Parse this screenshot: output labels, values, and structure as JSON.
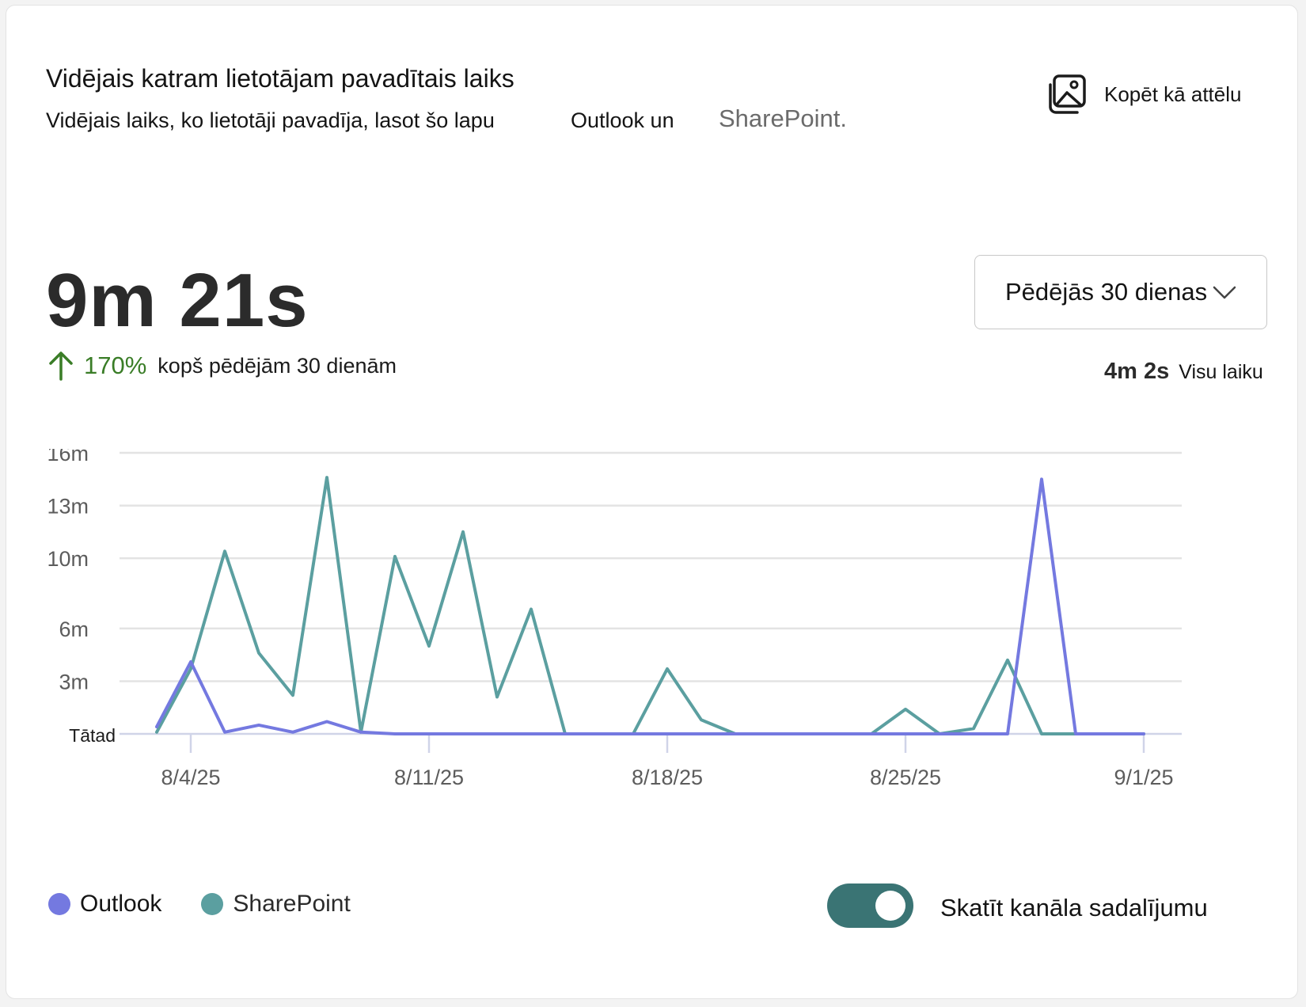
{
  "header": {
    "title": "Vidējais katram lietotājam pavadītais laiks",
    "subtitle": "Vidējais laiks, ko lietotāji pavadīja, lasot šo lapu",
    "subtitle_outlook": "Outlook un",
    "subtitle_sharepoint": "SharePoint.",
    "copy_label": "Kopēt kā attēlu",
    "copy_icon": "image-icon"
  },
  "summary": {
    "value": "9m 21s",
    "change_percent": "170%",
    "change_text": "kopš pēdējām 30 dienām",
    "change_icon": "arrow-up-icon",
    "all_time_value": "4m 2s",
    "all_time_label": "Visu laiku"
  },
  "period_select": {
    "selected": "Pēdējās 30 dienas",
    "icon": "chevron-down-icon"
  },
  "colors": {
    "outlook": "#7479e0",
    "sharepoint": "#5b9fa0",
    "positive": "#3a7d27",
    "toggle": "#3a7474",
    "grid": "#e3e3e3"
  },
  "chart_data": {
    "type": "line",
    "x": [
      "8/3/25",
      "8/4/25",
      "8/5/25",
      "8/6/25",
      "8/7/25",
      "8/8/25",
      "8/9/25",
      "8/10/25",
      "8/11/25",
      "8/12/25",
      "8/13/25",
      "8/14/25",
      "8/15/25",
      "8/16/25",
      "8/17/25",
      "8/18/25",
      "8/19/25",
      "8/20/25",
      "8/21/25",
      "8/22/25",
      "8/23/25",
      "8/24/25",
      "8/25/25",
      "8/26/25",
      "8/27/25",
      "8/28/25",
      "8/29/25",
      "8/30/25",
      "8/31/25",
      "9/1/25"
    ],
    "x_ticks": [
      "8/4/25",
      "8/11/25",
      "8/18/25",
      "8/25/25",
      "9/1/25"
    ],
    "y_ticks": [
      "Tātad",
      "3m",
      "6m",
      "10m",
      "13m",
      "16m"
    ],
    "y_tick_values": [
      0,
      3,
      6,
      10,
      13,
      16
    ],
    "ylim": [
      0,
      16
    ],
    "grid": true,
    "legend_position": "bottom-left",
    "series": [
      {
        "name": "Outlook",
        "values": [
          0.4,
          4.1,
          0.1,
          0.5,
          0.1,
          0.7,
          0.1,
          0,
          0,
          0,
          0,
          0,
          0,
          0,
          0,
          0,
          0,
          0,
          0,
          0,
          0,
          0,
          0,
          0,
          0,
          0,
          14.5,
          0,
          0,
          0
        ]
      },
      {
        "name": "SharePoint",
        "values": [
          0.1,
          3.7,
          10.4,
          4.6,
          2.2,
          14.6,
          0.1,
          10.1,
          5.0,
          11.5,
          2.1,
          7.1,
          0,
          0,
          0,
          3.7,
          0.8,
          0,
          0,
          0,
          0,
          0,
          1.4,
          0,
          0.3,
          4.2,
          0,
          0,
          0,
          0
        ]
      }
    ]
  },
  "toggle": {
    "label": "Skatīt kanāla sadalījumu",
    "on": true
  }
}
